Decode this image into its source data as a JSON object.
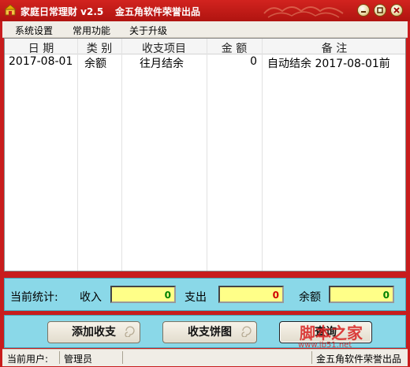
{
  "window": {
    "title": "家庭日常理财 v2.5",
    "subtitle": "金五角软件荣誉出品"
  },
  "menu": [
    "系统设置",
    "常用功能",
    "关于升级"
  ],
  "table": {
    "columns": [
      "日  期",
      "类 别",
      "收支项目",
      "金 额",
      "备  注"
    ],
    "rows": [
      {
        "date": "2017-08-01",
        "category": "余额",
        "item": "往月结余",
        "amount": "0",
        "note": "自动结余 2017-08-01前"
      }
    ]
  },
  "stats": {
    "label": "当前统计:",
    "income_label": "收入",
    "income_value": "0",
    "income_color": "#008000",
    "expense_label": "支出",
    "expense_value": "0",
    "expense_color": "#d00000",
    "balance_label": "余额",
    "balance_value": "0",
    "balance_color": "#008000"
  },
  "buttons": {
    "add": "添加收支",
    "pie": "收支饼图",
    "query": "查询"
  },
  "status": {
    "user_label": "当前用户:",
    "user_value": "管理员",
    "brand": "金五角软件荣誉出品"
  },
  "watermark": {
    "text": "脚本之家",
    "url": "www.jb51.net"
  },
  "colors": {
    "titlebar": "#c81c1c",
    "panel": "#8ad8e8",
    "value_box": "#ffff88"
  }
}
